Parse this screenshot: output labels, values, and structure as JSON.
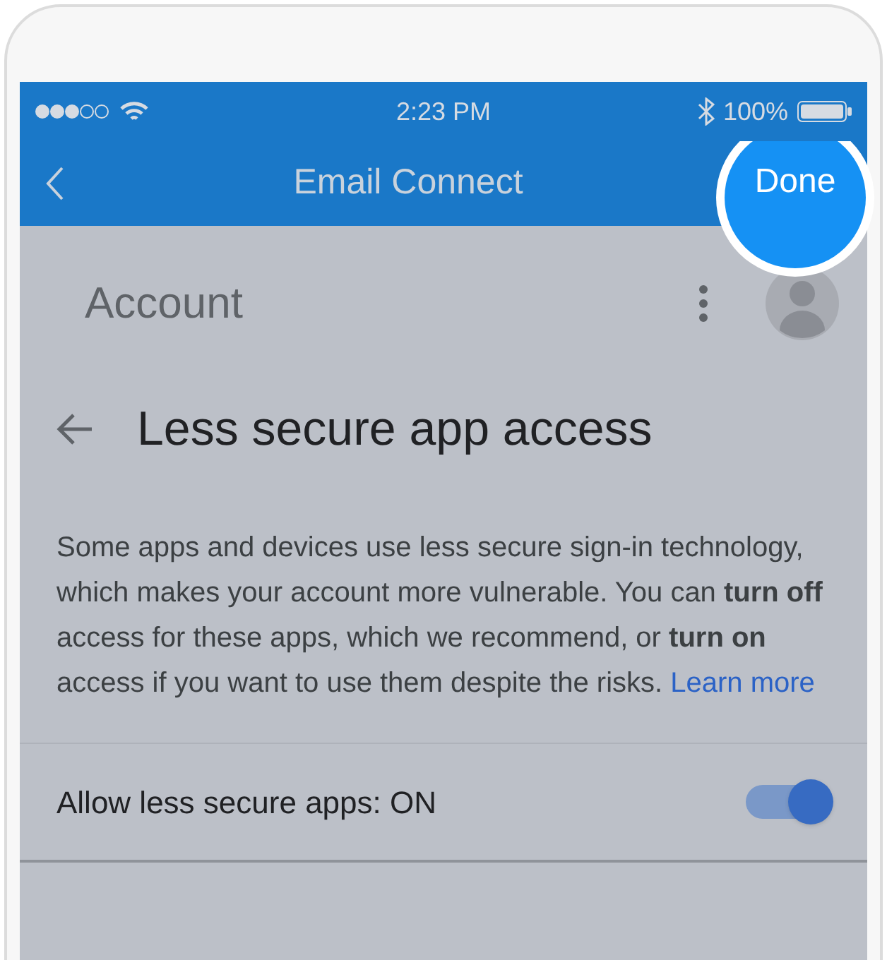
{
  "status_bar": {
    "time": "2:23 PM",
    "battery": "100%"
  },
  "nav_bar": {
    "title": "Email Connect",
    "done_button": "Done",
    "done_highlighted": true
  },
  "account_header": {
    "title": "Account"
  },
  "page": {
    "title": "Less secure app access",
    "description": "Some apps and devices use less secure sign-in technology, which makes your account more vulnerable. You can **turn off** access for these apps, which we recommend, or **turn on** access if you want to use them despite the risks.",
    "learn_more_link": "Learn more"
  },
  "setting": {
    "label": "Allow less secure apps: ON",
    "on": true
  }
}
